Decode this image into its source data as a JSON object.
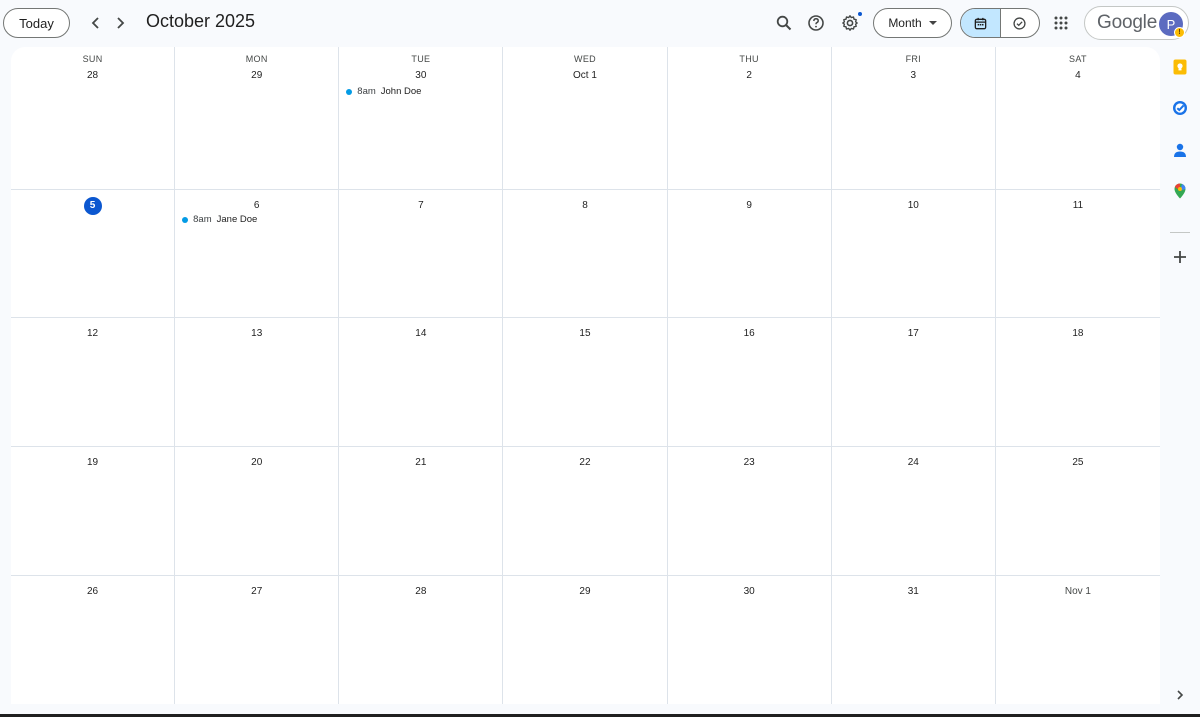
{
  "header": {
    "today_label": "Today",
    "title": "October 2025",
    "view_label": "Month",
    "brand": "Google",
    "avatar_initial": "P"
  },
  "colors": {
    "accent": "#0b57d0",
    "event_dot": "#039be5",
    "toggle_active": "#c2e7ff"
  },
  "icons": {
    "prev": "chevron-left-icon",
    "next": "chevron-right-icon",
    "search": "search-icon",
    "help": "help-icon",
    "settings": "gear-icon",
    "calendar_view": "calendar-icon",
    "tasks_view": "check-circle-icon",
    "apps": "apps-grid-icon",
    "side_keep": "keep-icon",
    "side_tasks": "tasks-icon",
    "side_contacts": "contacts-icon",
    "side_maps": "maps-icon",
    "side_add": "plus-icon",
    "side_expand": "chevron-right-icon"
  },
  "calendar": {
    "weekdays": [
      "SUN",
      "MON",
      "TUE",
      "WED",
      "THU",
      "FRI",
      "SAT"
    ],
    "weeks": [
      [
        {
          "label": "28"
        },
        {
          "label": "29"
        },
        {
          "label": "30",
          "events": [
            {
              "time": "8am",
              "title": "John Doe"
            }
          ]
        },
        {
          "label": "Oct 1"
        },
        {
          "label": "2"
        },
        {
          "label": "3"
        },
        {
          "label": "4"
        }
      ],
      [
        {
          "label": "5",
          "today": true
        },
        {
          "label": "6",
          "events": [
            {
              "time": "8am",
              "title": "Jane Doe"
            }
          ]
        },
        {
          "label": "7"
        },
        {
          "label": "8"
        },
        {
          "label": "9"
        },
        {
          "label": "10"
        },
        {
          "label": "11"
        }
      ],
      [
        {
          "label": "12"
        },
        {
          "label": "13"
        },
        {
          "label": "14"
        },
        {
          "label": "15"
        },
        {
          "label": "16"
        },
        {
          "label": "17"
        },
        {
          "label": "18"
        }
      ],
      [
        {
          "label": "19"
        },
        {
          "label": "20"
        },
        {
          "label": "21"
        },
        {
          "label": "22"
        },
        {
          "label": "23"
        },
        {
          "label": "24"
        },
        {
          "label": "25"
        }
      ],
      [
        {
          "label": "26"
        },
        {
          "label": "27"
        },
        {
          "label": "28"
        },
        {
          "label": "29"
        },
        {
          "label": "30"
        },
        {
          "label": "31"
        },
        {
          "label": "Nov 1",
          "muted": true
        }
      ]
    ]
  }
}
